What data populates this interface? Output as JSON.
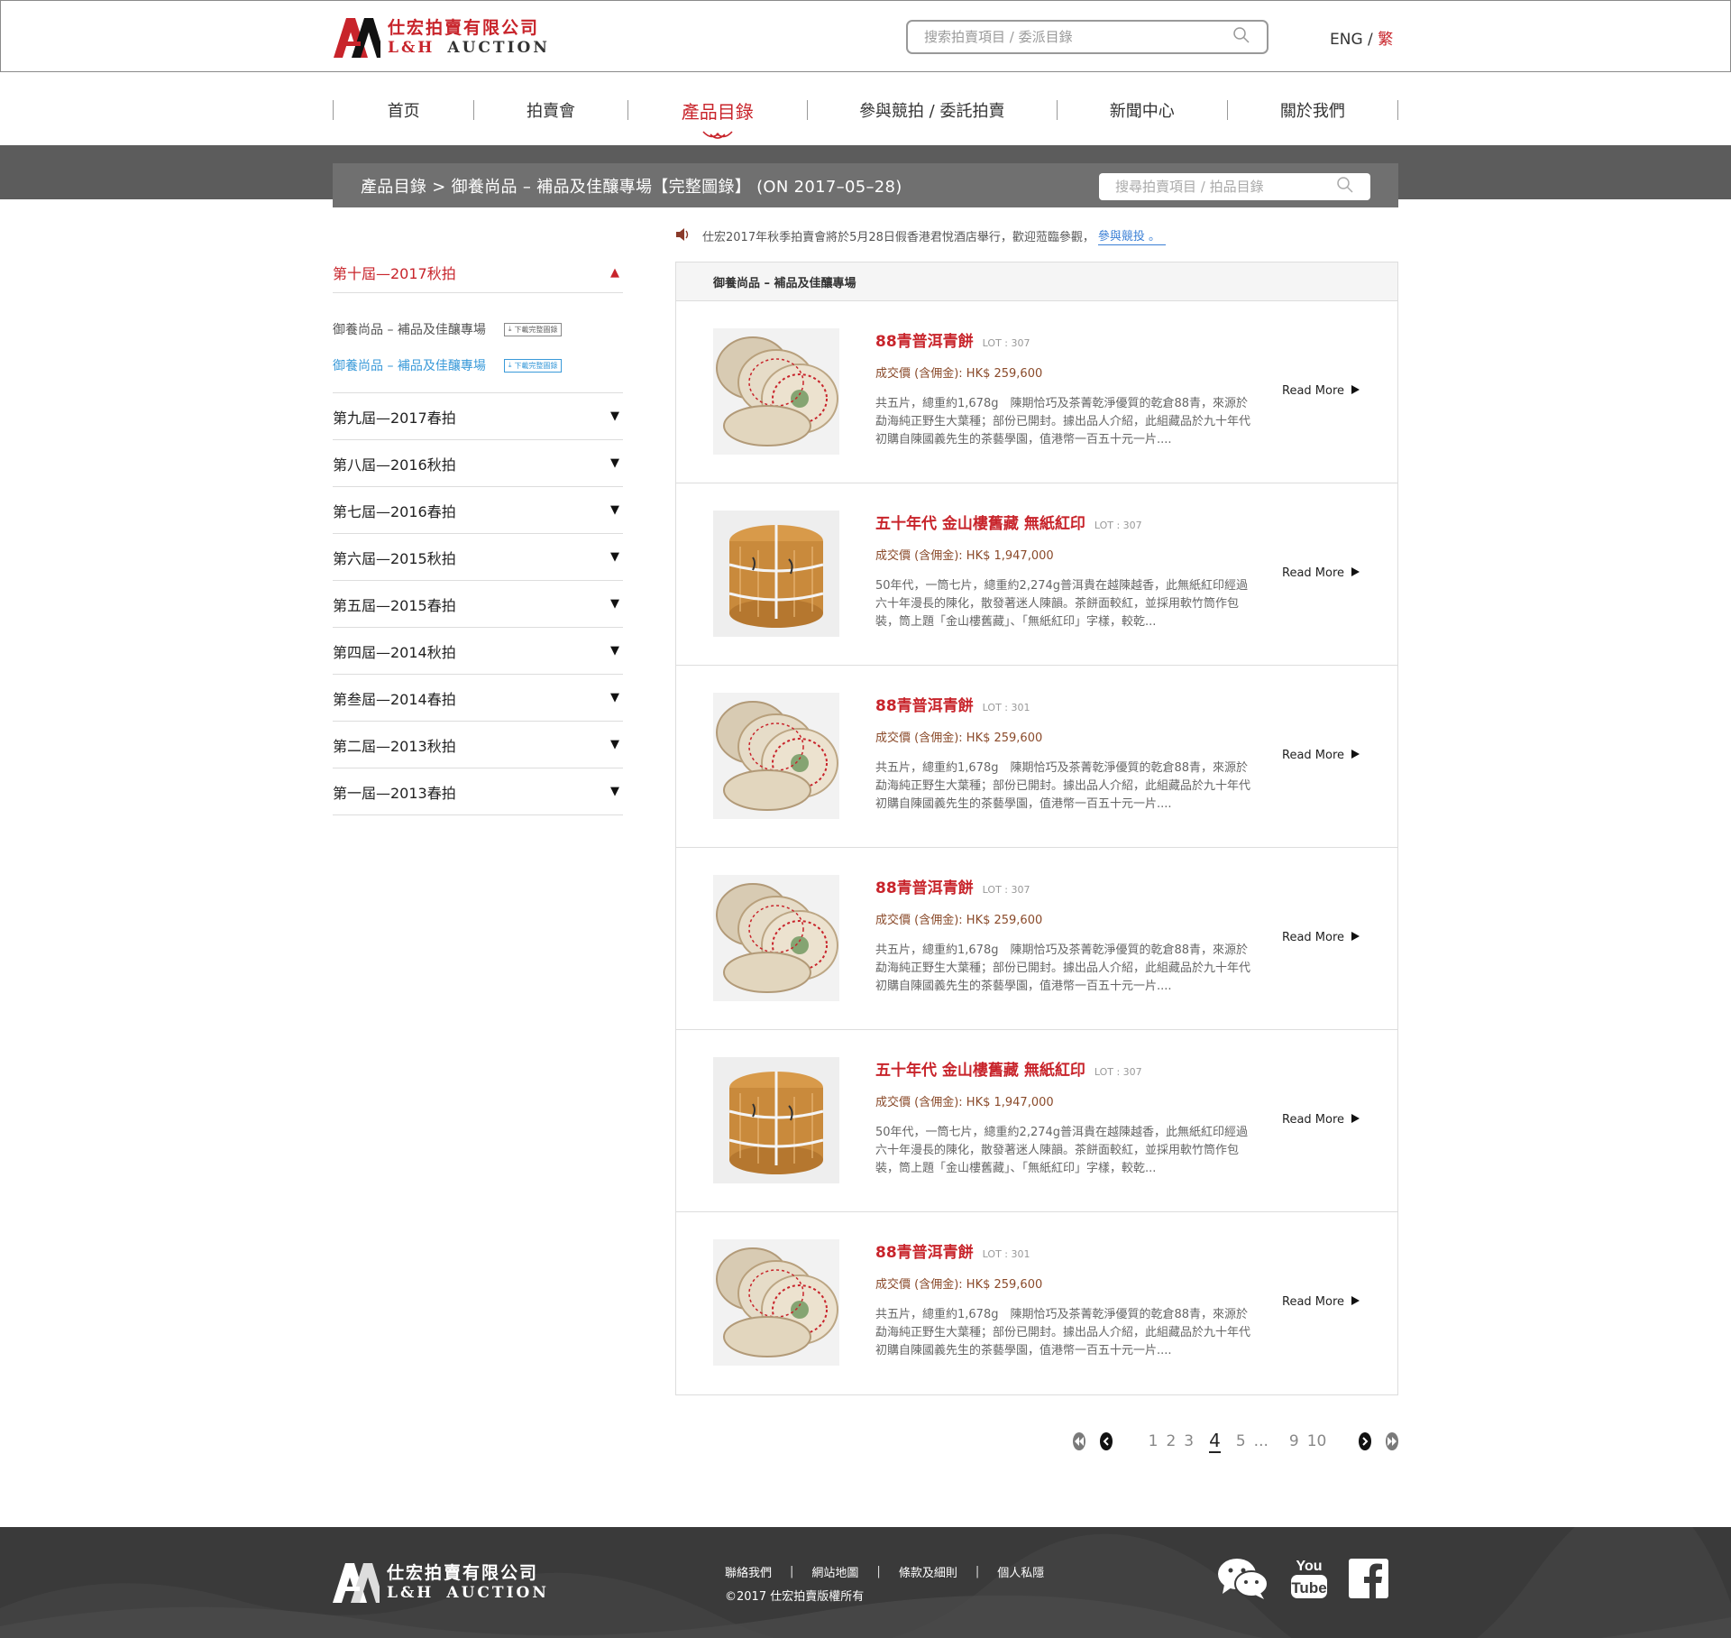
{
  "brand": {
    "name_cn": "仕宏拍賣有限公司",
    "name_en_prefix": "L&H",
    "name_en_suffix": "AUCTION",
    "accent": "#c8242b"
  },
  "header": {
    "search_placeholder": "搜索拍賣項目 / 委派目錄",
    "lang_en": "ENG",
    "lang_sep": "/",
    "lang_tc": "繁"
  },
  "nav": {
    "items": [
      {
        "label": "首页"
      },
      {
        "label": "拍賣會"
      },
      {
        "label": "產品目錄"
      },
      {
        "label": "參與競拍 / 委託拍賣"
      },
      {
        "label": "新聞中心"
      },
      {
        "label": "關於我們"
      }
    ],
    "active": "產品目錄"
  },
  "banner": {
    "breadcrumb": "產品目錄 > 御養尚品 – 補品及佳釀專場【完整圖錄】 (ON 2017–05–28)",
    "search_placeholder": "搜尋拍賣項目 / 拍品目錄"
  },
  "notice": {
    "text": "仕宏2017年秋季拍賣會將於5月28日假香港君悅酒店舉行，歡迎蒞臨參觀，",
    "link": "參與競投 。"
  },
  "sidebar": {
    "open_section": "第十屆—2017秋拍",
    "sub_items": [
      {
        "label": "御養尚品 – 補品及佳釀專場",
        "badge": "下載完整圖錄"
      },
      {
        "label": "御養尚品 – 補品及佳釀專場",
        "badge": "下載完整圖錄"
      }
    ],
    "sections": [
      {
        "label": "第九屆—2017春拍"
      },
      {
        "label": "第八屆—2016秋拍"
      },
      {
        "label": "第七屆—2016春拍"
      },
      {
        "label": "第六屆—2015秋拍"
      },
      {
        "label": "第五屆—2015春拍"
      },
      {
        "label": "第四屆—2014秋拍"
      },
      {
        "label": "第叁屆—2014春拍"
      },
      {
        "label": "第二屆—2013秋拍"
      },
      {
        "label": "第一屆—2013春拍"
      }
    ]
  },
  "list": {
    "heading": "御養尚品 – 補品及佳釀專場",
    "read_more": "Read More",
    "items": [
      {
        "title": "88青普洱青餅",
        "lot": "LOT : 307",
        "price": "成交價 (含佣金): HK$ 259,600",
        "desc": "共五片，總重約1,678g　陳期恰巧及茶菁乾淨優質的乾倉88青，來源於勐海純正野生大葉種；部份已開封。據出品人介紹，此組藏品於九十年代初購自陳國義先生的茶藝學園，值港幣一百五十元一片....",
        "image": "stacked-tea-cakes"
      },
      {
        "title": "五十年代 金山樓舊藏 無紙紅印",
        "lot": "LOT : 307",
        "price": "成交價 (含佣金): HK$ 1,947,000",
        "desc": "50年代，一筒七片，總重約2,274g普洱貴在越陳越香，此無紙紅印經過六十年漫長的陳化，散發著迷人陳韻。茶餅面較紅，並採用軟竹筒作包裝，筒上題「金山樓舊藏」、「無紙紅印」字樣，較乾...",
        "image": "bamboo-wrapped-tea"
      },
      {
        "title": "88青普洱青餅",
        "lot": "LOT : 301",
        "price": "成交價 (含佣金): HK$ 259,600",
        "desc": "共五片，總重約1,678g　陳期恰巧及茶菁乾淨優質的乾倉88青，來源於勐海純正野生大葉種；部份已開封。據出品人介紹，此組藏品於九十年代初購自陳國義先生的茶藝學園，值港幣一百五十元一片....",
        "image": "stacked-tea-cakes"
      },
      {
        "title": "88青普洱青餅",
        "lot": "LOT : 307",
        "price": "成交價 (含佣金): HK$ 259,600",
        "desc": "共五片，總重約1,678g　陳期恰巧及茶菁乾淨優質的乾倉88青，來源於勐海純正野生大葉種；部份已開封。據出品人介紹，此組藏品於九十年代初購自陳國義先生的茶藝學園，值港幣一百五十元一片....",
        "image": "stacked-tea-cakes"
      },
      {
        "title": "五十年代 金山樓舊藏 無紙紅印",
        "lot": "LOT : 307",
        "price": "成交價 (含佣金): HK$ 1,947,000",
        "desc": "50年代，一筒七片，總重約2,274g普洱貴在越陳越香，此無紙紅印經過六十年漫長的陳化，散發著迷人陳韻。茶餅面較紅，並採用軟竹筒作包裝，筒上題「金山樓舊藏」、「無紙紅印」字樣，較乾...",
        "image": "bamboo-wrapped-tea"
      },
      {
        "title": "88青普洱青餅",
        "lot": "LOT : 301",
        "price": "成交價 (含佣金): HK$ 259,600",
        "desc": "共五片，總重約1,678g　陳期恰巧及茶菁乾淨優質的乾倉88青，來源於勐海純正野生大葉種；部份已開封。據出品人介紹，此組藏品於九十年代初購自陳國義先生的茶藝學園，值港幣一百五十元一片....",
        "image": "stacked-tea-cakes"
      }
    ]
  },
  "pagination": {
    "pages": [
      "1",
      "2",
      "3",
      "4",
      "5",
      "...",
      "9",
      "10"
    ],
    "current": "4"
  },
  "footer": {
    "links": [
      "聯絡我們",
      "網站地圖",
      "條款及細則",
      "個人私隱"
    ],
    "copyright": "©2017 仕宏拍賣版權所有",
    "social": [
      "wechat-icon",
      "youtube-icon",
      "facebook-icon"
    ],
    "youtube_top": "You",
    "youtube_bottom": "Tube"
  }
}
